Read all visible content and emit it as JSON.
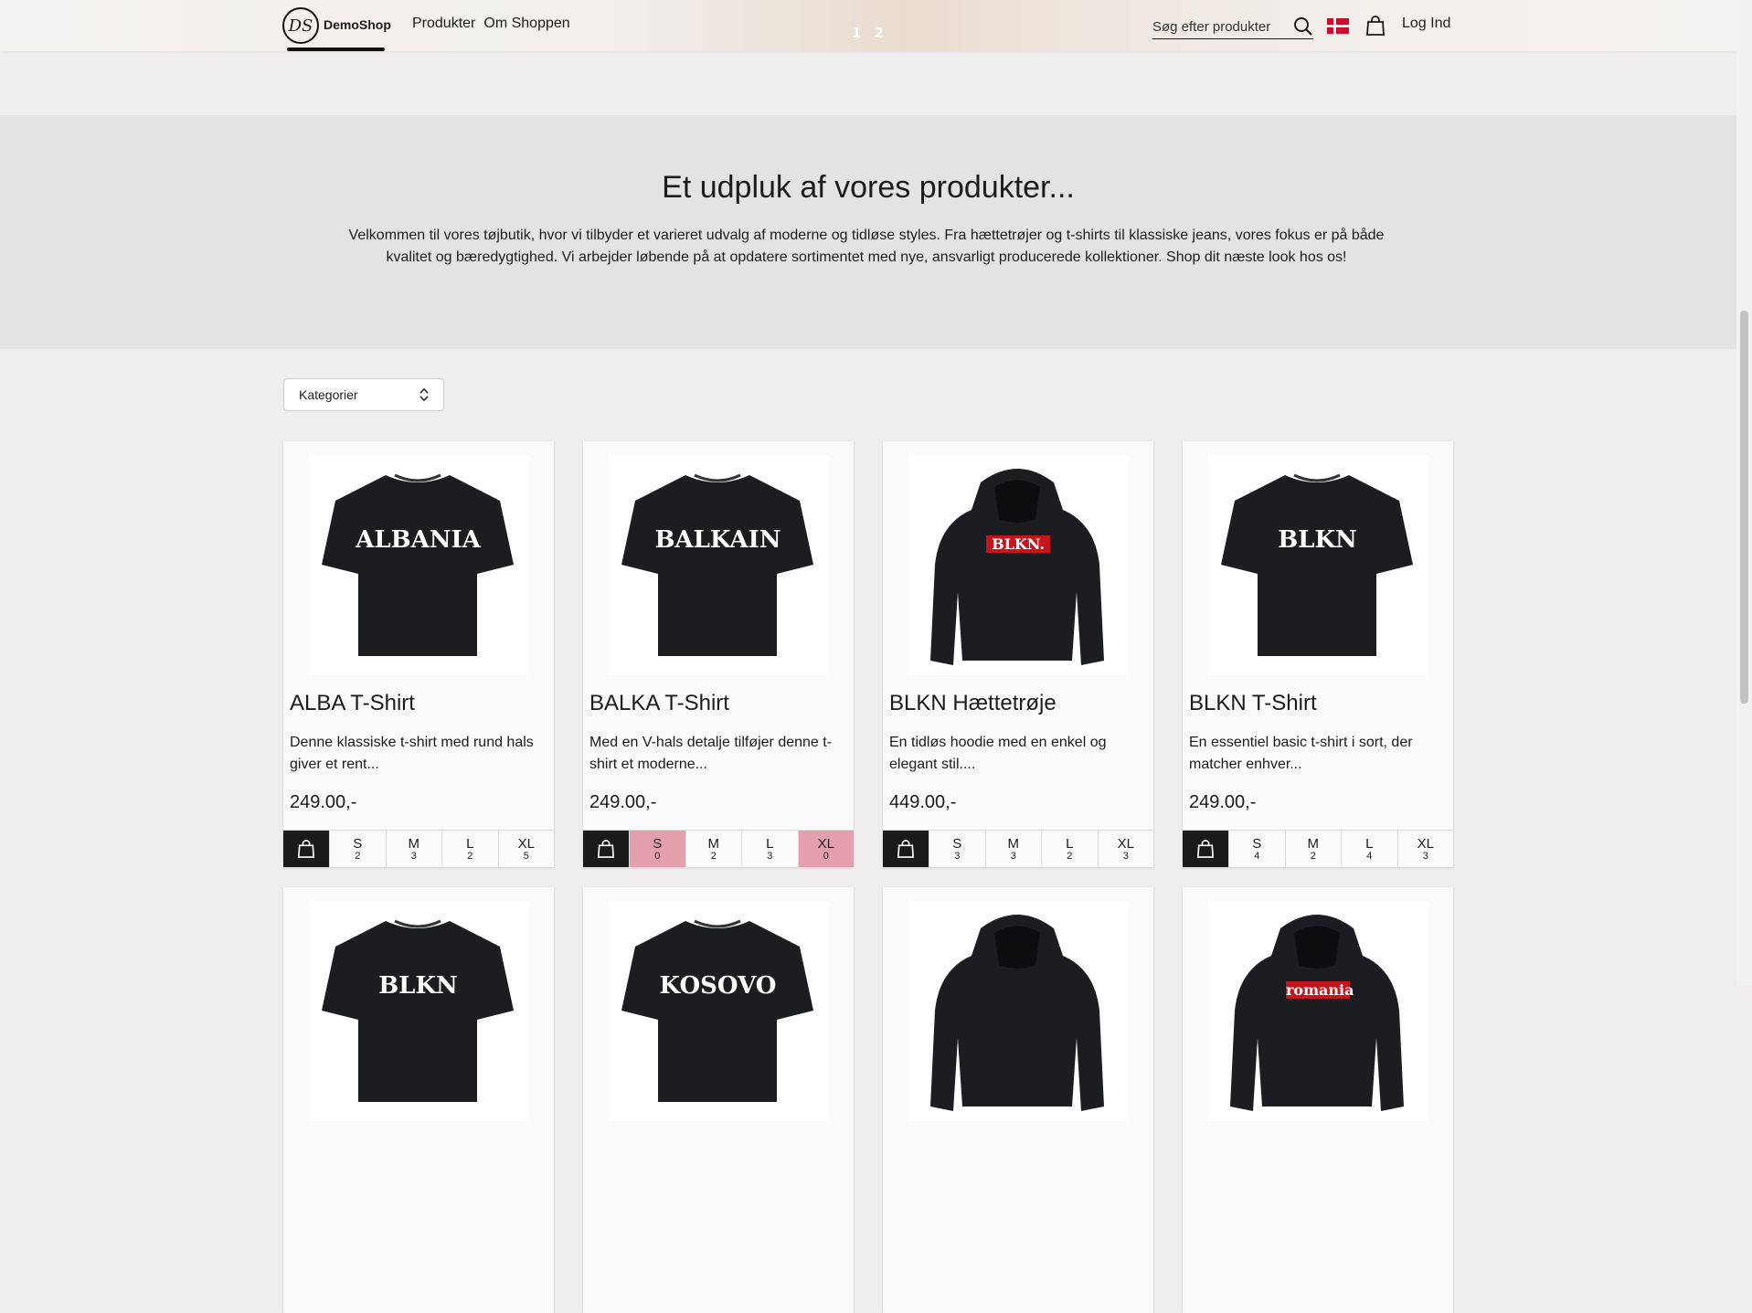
{
  "header": {
    "brand": "DemoShop",
    "logo_text": "DS",
    "nav": [
      "Produkter",
      "Om Shoppen"
    ],
    "pager": [
      "1",
      "2"
    ],
    "search_placeholder": "Søg efter produkter",
    "login": "Log Ind"
  },
  "hero": {
    "title": "Et udpluk af vores produkter...",
    "text": "Velkommen til vores tøjbutik, hvor vi tilbyder et varieret udvalg af moderne og tidløse styles. Fra hættetrøjer og t-shirts til klassiske jeans, vores fokus er på både kvalitet og bæredygtighed. Vi arbejder løbende på at opdatere sortimentet med nye, ansvarligt producerede kollektioner. Shop dit næste look hos os!"
  },
  "filter": {
    "category_label": "Kategorier"
  },
  "products": [
    {
      "name": "ALBA T-Shirt",
      "desc": "Denne klassiske t-shirt med rund hals giver et rent...",
      "price": "249.00,-",
      "print": "ALBANIA",
      "type": "tee",
      "sizes": [
        {
          "s": "S",
          "q": "2"
        },
        {
          "s": "M",
          "q": "3"
        },
        {
          "s": "L",
          "q": "2"
        },
        {
          "s": "XL",
          "q": "5"
        }
      ]
    },
    {
      "name": "BALKA T-Shirt",
      "desc": "Med en V-hals detalje tilføjer denne t-shirt et moderne...",
      "price": "249.00,-",
      "print": "BALKAIN",
      "type": "tee",
      "sizes": [
        {
          "s": "S",
          "q": "0"
        },
        {
          "s": "M",
          "q": "2"
        },
        {
          "s": "L",
          "q": "3"
        },
        {
          "s": "XL",
          "q": "0"
        }
      ]
    },
    {
      "name": "BLKN Hættetrøje",
      "desc": "En tidløs hoodie med en enkel og elegant stil....",
      "price": "449.00,-",
      "print": "BLKN.",
      "type": "hoodie",
      "sizes": [
        {
          "s": "S",
          "q": "3"
        },
        {
          "s": "M",
          "q": "3"
        },
        {
          "s": "L",
          "q": "2"
        },
        {
          "s": "XL",
          "q": "3"
        }
      ]
    },
    {
      "name": "BLKN T-Shirt",
      "desc": "En essentiel basic t-shirt i sort, der matcher enhver...",
      "price": "249.00,-",
      "print": "BLKN",
      "type": "tee",
      "sizes": [
        {
          "s": "S",
          "q": "4"
        },
        {
          "s": "M",
          "q": "2"
        },
        {
          "s": "L",
          "q": "4"
        },
        {
          "s": "XL",
          "q": "3"
        }
      ]
    },
    {
      "print": "BLKN",
      "type": "tee"
    },
    {
      "print": "KOSOVO",
      "type": "tee"
    },
    {
      "print": "",
      "type": "hoodie"
    },
    {
      "print": "romania",
      "type": "hoodie"
    }
  ],
  "colors": {
    "out_of_stock": "#e3a0ac",
    "buy_button": "#1a1a1a"
  }
}
